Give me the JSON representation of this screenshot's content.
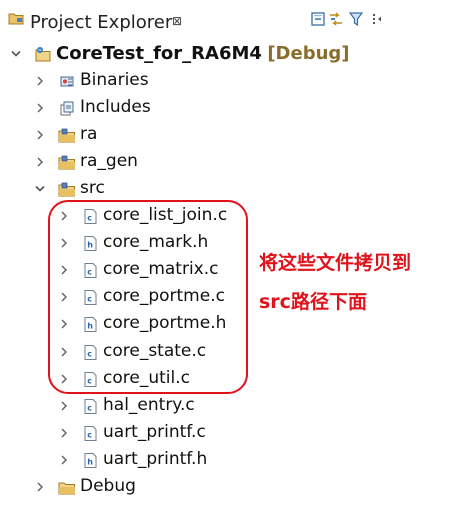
{
  "view": {
    "title": "Project Explorer",
    "close_glyph": "⊠",
    "toolbar_icons": [
      "collapse-all-icon",
      "link-with-editor-icon",
      "filter-icon",
      "view-menu-icon"
    ]
  },
  "tree": {
    "project": {
      "name": "CoreTest_for_RA6M4",
      "decoration": "[Debug]",
      "icon": "project-icon",
      "expanded": true
    },
    "items": [
      {
        "label": "Binaries",
        "icon": "binaries-icon",
        "level": 1,
        "expanded": false
      },
      {
        "label": "Includes",
        "icon": "includes-icon",
        "level": 1,
        "expanded": false
      },
      {
        "label": "ra",
        "icon": "source-folder-icon",
        "level": 1,
        "expanded": false
      },
      {
        "label": "ra_gen",
        "icon": "source-folder-icon",
        "level": 1,
        "expanded": false
      },
      {
        "label": "src",
        "icon": "source-folder-icon",
        "level": 1,
        "expanded": true
      },
      {
        "label": "core_list_join.c",
        "icon": "c-file-icon",
        "level": 2,
        "expanded": false
      },
      {
        "label": "core_mark.h",
        "icon": "h-file-icon",
        "level": 2,
        "expanded": false
      },
      {
        "label": "core_matrix.c",
        "icon": "c-file-icon",
        "level": 2,
        "expanded": false
      },
      {
        "label": "core_portme.c",
        "icon": "c-file-icon",
        "level": 2,
        "expanded": false
      },
      {
        "label": "core_portme.h",
        "icon": "h-file-icon",
        "level": 2,
        "expanded": false
      },
      {
        "label": "core_state.c",
        "icon": "c-file-icon",
        "level": 2,
        "expanded": false
      },
      {
        "label": "core_util.c",
        "icon": "c-file-icon",
        "level": 2,
        "expanded": false
      },
      {
        "label": "hal_entry.c",
        "icon": "c-file-icon",
        "level": 2,
        "expanded": false
      },
      {
        "label": "uart_printf.c",
        "icon": "c-file-icon",
        "level": 2,
        "expanded": false
      },
      {
        "label": "uart_printf.h",
        "icon": "h-file-icon",
        "level": 2,
        "expanded": false
      },
      {
        "label": "Debug",
        "icon": "folder-icon",
        "level": 1,
        "expanded": false
      }
    ]
  },
  "annotation": {
    "line1": "将这些文件拷贝到",
    "line2": "src路径下面",
    "color": "#e0121b"
  }
}
